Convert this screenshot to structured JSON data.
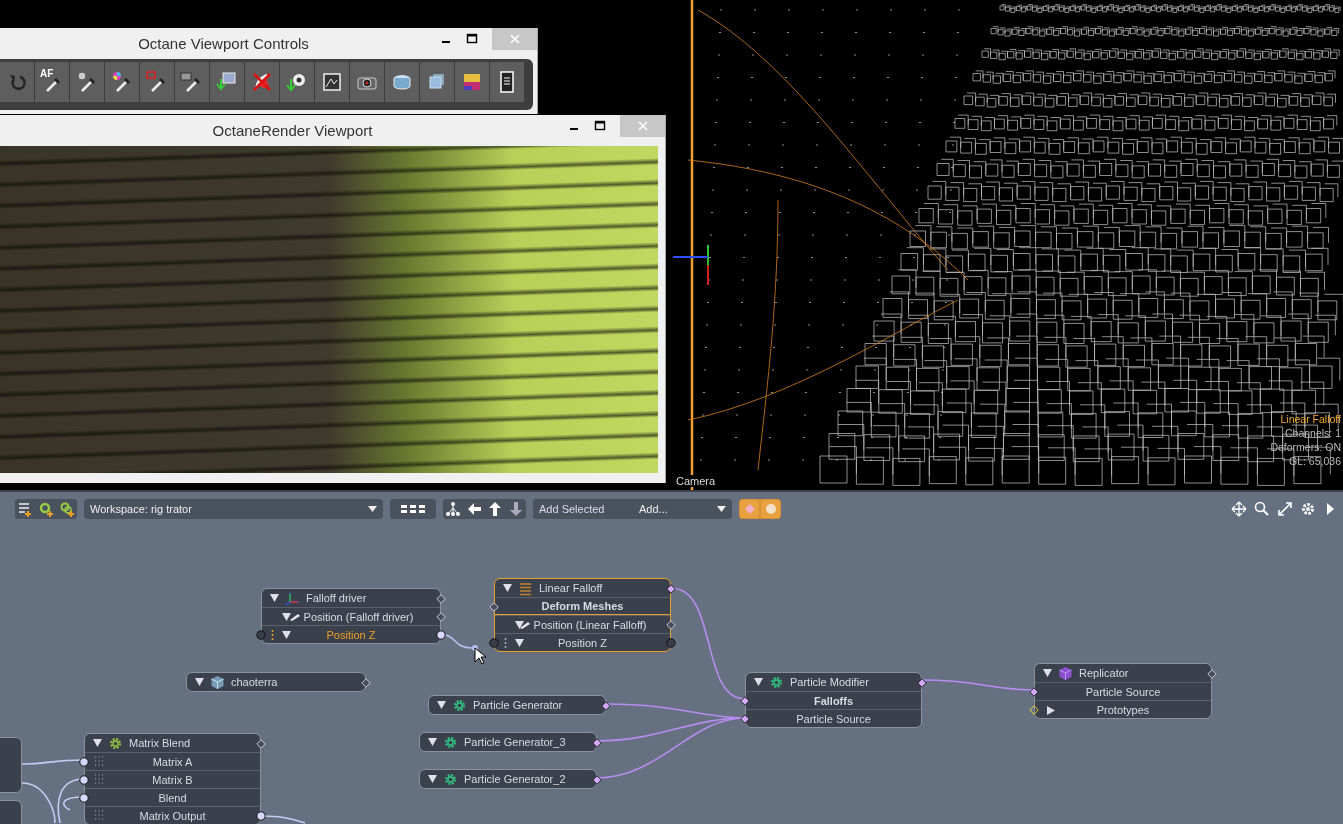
{
  "viewport_controls_window": {
    "title": "Octane Viewport Controls",
    "tool_label": "AF"
  },
  "render_window": {
    "title": "OctaneRender Viewport"
  },
  "viewport_3d": {
    "camera_label": "Camera",
    "overlay": [
      {
        "text": "Linear Falloff",
        "kind": "title"
      },
      {
        "text": "Channels: 1",
        "kind": "info"
      },
      {
        "text": "Deformers: ON",
        "kind": "info"
      },
      {
        "text": "GL: 65,036",
        "kind": "info"
      }
    ]
  },
  "node_editor": {
    "workspace": "Workspace: rig trator",
    "add_selected": "Add Selected",
    "add_menu": "Add...",
    "nodes": [
      {
        "title": "Falloff driver",
        "selected": false,
        "rows": [
          {
            "kind": "group",
            "label": "Position (Falloff driver)",
            "highlighted": false
          },
          {
            "kind": "channel",
            "label": "Position Z",
            "highlighted": true
          }
        ]
      },
      {
        "title": "Linear Falloff",
        "selected": true,
        "rows": [
          {
            "kind": "section",
            "label": "Deform Meshes",
            "highlighted": false
          },
          {
            "kind": "group",
            "label": "Position (Linear Falloff)",
            "highlighted": false
          },
          {
            "kind": "channel",
            "label": "Position Z",
            "highlighted": false
          }
        ]
      },
      {
        "title": "chaoterra",
        "selected": false
      },
      {
        "title": "Particle Generator",
        "selected": false
      },
      {
        "title": "Particle Generator_3",
        "selected": false
      },
      {
        "title": "Particle Generator_2",
        "selected": false
      },
      {
        "title": "Particle Modifier",
        "selected": false,
        "rows": [
          {
            "kind": "section",
            "label": "Falloffs",
            "highlighted": false
          },
          {
            "kind": "plain",
            "label": "Particle Source",
            "highlighted": false
          }
        ]
      },
      {
        "title": "Replicator",
        "selected": false,
        "rows": [
          {
            "kind": "plain",
            "label": "Particle Source",
            "highlighted": false
          },
          {
            "kind": "expand",
            "label": "Prototypes",
            "highlighted": false
          }
        ]
      },
      {
        "title": "Matrix Blend",
        "selected": false,
        "rows": [
          {
            "kind": "matrix",
            "label": "Matrix A",
            "highlighted": false
          },
          {
            "kind": "matrix",
            "label": "Matrix B",
            "highlighted": false
          },
          {
            "kind": "plain",
            "label": "Blend",
            "highlighted": false
          },
          {
            "kind": "matrix",
            "label": "Matrix Output",
            "highlighted": false
          }
        ]
      }
    ]
  }
}
